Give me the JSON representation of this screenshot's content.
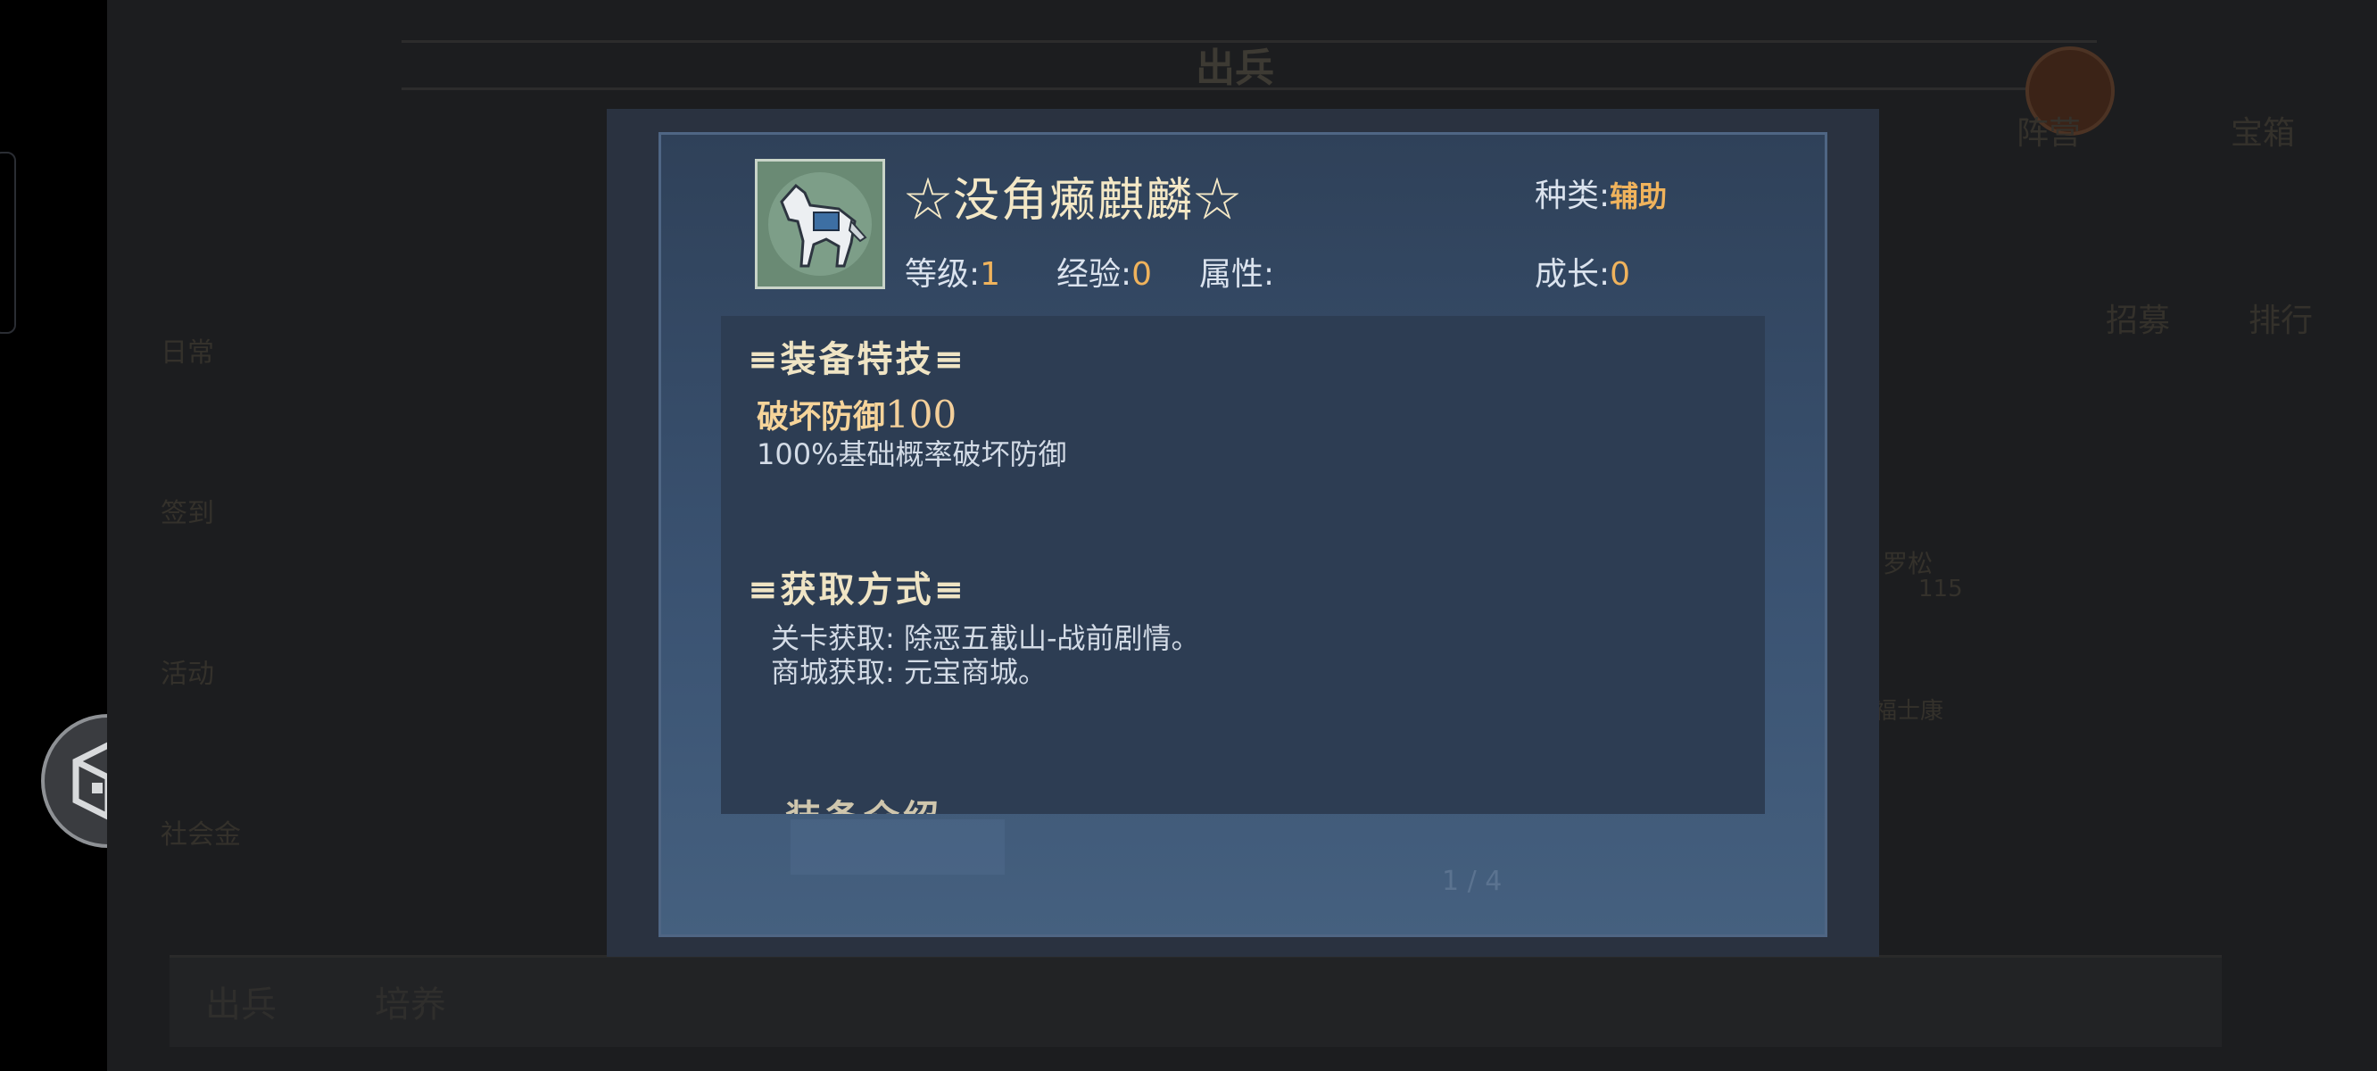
{
  "background": {
    "title": "出兵",
    "right_tabs": [
      "阵营",
      "宝箱"
    ],
    "right_tabs2": [
      "招募",
      "排行"
    ],
    "side_labels": [
      "日常",
      "签到",
      "活动",
      "社会金"
    ],
    "right_names": [
      "罗松",
      "福士康"
    ],
    "right_number": "115",
    "bottom_tabs": [
      "出兵",
      "培养"
    ],
    "page_indicator": "1 / 4"
  },
  "dialog": {
    "icon": "white-horse-icon",
    "name": "☆没角癞麒麟☆",
    "category_label": "种类:",
    "category_value": "辅助",
    "level_label": "等级:",
    "level_value": "1",
    "exp_label": "经验:",
    "exp_value": "0",
    "attr_label": "属性:",
    "growth_label": "成长:",
    "growth_value": "0",
    "special_title": "≡装备特技≡",
    "skill_name": "破坏防御",
    "skill_level": "100",
    "skill_desc": "100%基础概率破坏防御",
    "obtain_title": "≡获取方式≡",
    "obtain_stage_label": "关卡获取:",
    "obtain_stage_value": "除恶五截山-战前剧情。",
    "obtain_shop_label": "商城获取:",
    "obtain_shop_value": "元宝商城。",
    "intro_title_cut": "装备介绍"
  },
  "colors": {
    "accent_value": "#f0b35c",
    "panel": "#2d3d53",
    "dialog": "#3a5271"
  }
}
